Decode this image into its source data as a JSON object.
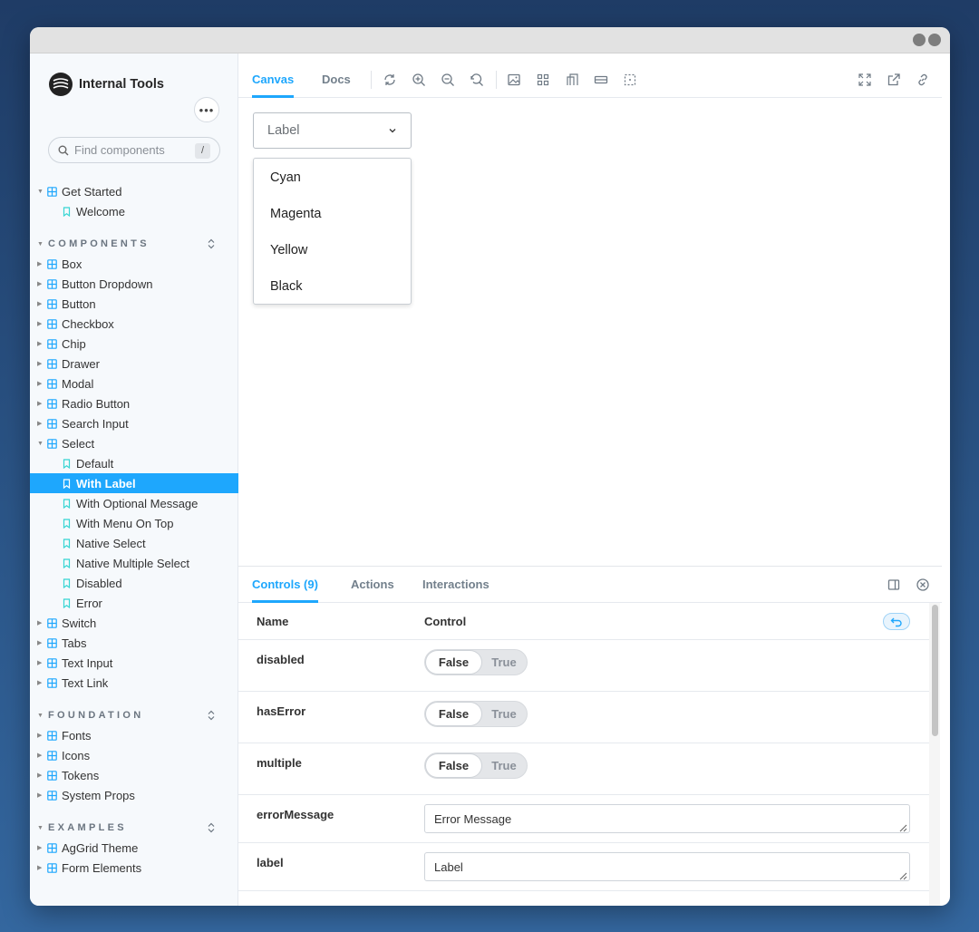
{
  "brand": {
    "name": "Internal Tools"
  },
  "search": {
    "placeholder": "Find components",
    "shortcut": "/"
  },
  "sidebar": {
    "get_started": {
      "label": "Get Started",
      "stories": [
        "Welcome"
      ]
    },
    "sections": [
      {
        "title": "COMPONENTS",
        "items": [
          "Box",
          "Button Dropdown",
          "Button",
          "Checkbox",
          "Chip",
          "Drawer",
          "Modal",
          "Radio Button",
          "Search Input"
        ],
        "expanded": {
          "label": "Select",
          "stories": [
            "Default",
            "With Label",
            "With Optional Message",
            "With Menu On Top",
            "Native Select",
            "Native Multiple Select",
            "Disabled",
            "Error"
          ],
          "active_story": "With Label"
        },
        "items_after": [
          "Switch",
          "Tabs",
          "Text Input",
          "Text Link"
        ]
      },
      {
        "title": "FOUNDATION",
        "items": [
          "Fonts",
          "Icons",
          "Tokens",
          "System Props"
        ]
      },
      {
        "title": "EXAMPLES",
        "items": [
          "AgGrid Theme",
          "Form Elements"
        ]
      }
    ]
  },
  "toolbar": {
    "tabs": [
      "Canvas",
      "Docs"
    ],
    "active_tab": "Canvas"
  },
  "canvas": {
    "select": {
      "value": "Label"
    },
    "menu_options": [
      "Cyan",
      "Magenta",
      "Yellow",
      "Black"
    ]
  },
  "addons": {
    "tabs": [
      "Controls (9)",
      "Actions",
      "Interactions"
    ],
    "active_tab": "Controls (9)",
    "headers": {
      "name": "Name",
      "control": "Control"
    },
    "rows": [
      {
        "name": "disabled",
        "type": "boolean",
        "false_label": "False",
        "true_label": "True",
        "value": false
      },
      {
        "name": "hasError",
        "type": "boolean",
        "false_label": "False",
        "true_label": "True",
        "value": false
      },
      {
        "name": "multiple",
        "type": "boolean",
        "false_label": "False",
        "true_label": "True",
        "value": false
      },
      {
        "name": "errorMessage",
        "type": "text",
        "value": "Error Message"
      },
      {
        "name": "label",
        "type": "text",
        "value": "Label"
      }
    ]
  },
  "colors": {
    "accent": "#1ea7fd",
    "sidebar_bg": "#f6f9fc"
  }
}
